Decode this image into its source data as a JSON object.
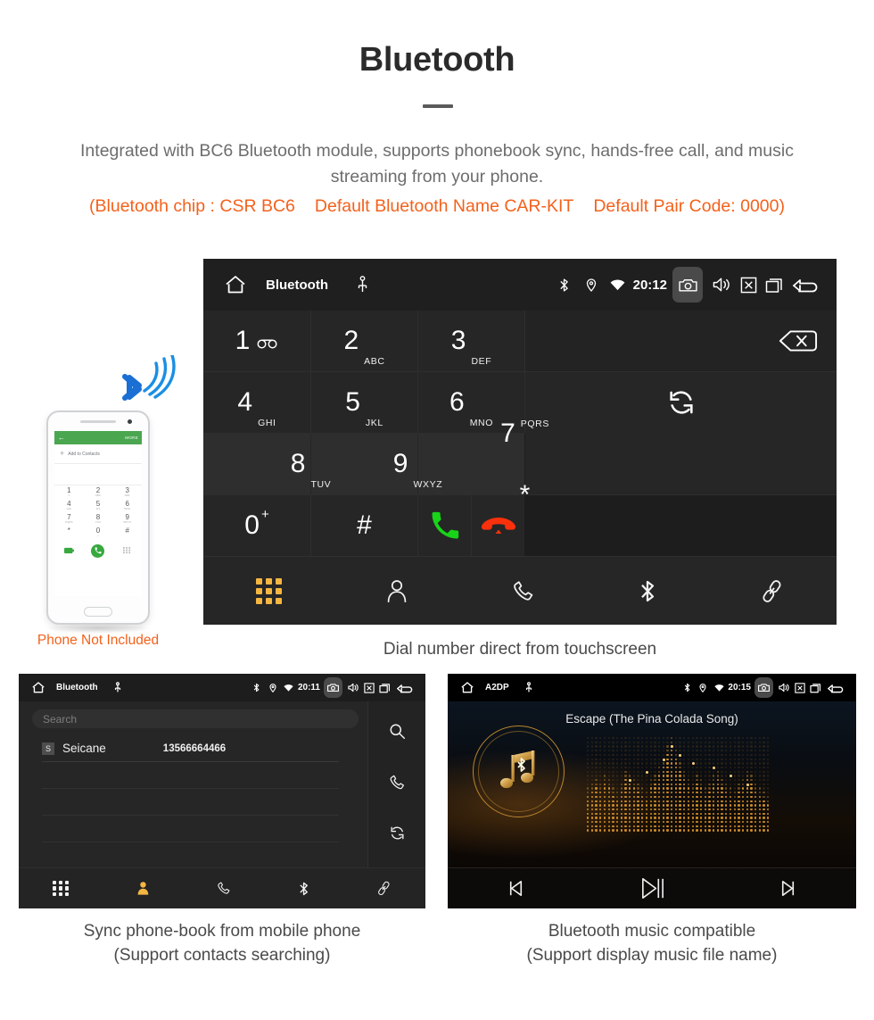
{
  "hero": {
    "title": "Bluetooth",
    "subtitle": "Integrated with BC6 Bluetooth module, supports phonebook sync, hands-free call, and music streaming from your phone.",
    "note_chip": "(Bluetooth chip : CSR BC6",
    "note_name": "Default Bluetooth Name CAR-KIT",
    "note_pair": "Default Pair Code: 0000)",
    "accent_color": "#f4611b",
    "text_color": "#6d6d6d"
  },
  "phone_illustration": {
    "caption": "Phone Not Included",
    "screen": {
      "back_glyph": "←",
      "more_label": "MORE",
      "add_plus": "+",
      "add_label": "Add to Contacts",
      "keys": [
        {
          "num": "1",
          "sub": "∞"
        },
        {
          "num": "2",
          "sub": "ABC"
        },
        {
          "num": "3",
          "sub": "DEF"
        },
        {
          "num": "4",
          "sub": "GHI"
        },
        {
          "num": "5",
          "sub": "JKL"
        },
        {
          "num": "6",
          "sub": "MNO"
        },
        {
          "num": "7",
          "sub": "PQRS"
        },
        {
          "num": "8",
          "sub": "TUV"
        },
        {
          "num": "9",
          "sub": "WXYZ"
        },
        {
          "num": "*",
          "sub": ""
        },
        {
          "num": "0",
          "sub": "+"
        },
        {
          "num": "#",
          "sub": ""
        }
      ]
    }
  },
  "dialer_unit": {
    "statusbar": {
      "home_icon": "home-icon",
      "title": "Bluetooth",
      "usb_icon": "usb-icon",
      "bluetooth_icon": "bluetooth-icon",
      "location_icon": "location-pin-icon",
      "wifi_icon": "wifi-icon",
      "clock": "20:12",
      "camera_icon": "camera-icon",
      "volume_icon": "speaker-icon",
      "close_icon": "close-box-icon",
      "recents_icon": "recents-icon",
      "back_icon": "back-arrow-icon"
    },
    "keys": [
      {
        "num": "1",
        "sub": "",
        "voicemail": true
      },
      {
        "num": "2",
        "sub": "ABC"
      },
      {
        "num": "3",
        "sub": "DEF"
      },
      {
        "num": "4",
        "sub": "GHI"
      },
      {
        "num": "5",
        "sub": "JKL"
      },
      {
        "num": "6",
        "sub": "MNO"
      },
      {
        "num": "7",
        "sub": "PQRS"
      },
      {
        "num": "8",
        "sub": "TUV"
      },
      {
        "num": "9",
        "sub": "WXYZ"
      },
      {
        "num": "*",
        "sub": ""
      },
      {
        "num": "0",
        "sub": "+"
      },
      {
        "num": "#",
        "sub": ""
      }
    ],
    "actions": {
      "backspace_icon": "backspace-icon",
      "sync_icon": "sync-icon",
      "call_icon": "call-icon",
      "hangup_icon": "hangup-icon",
      "call_color": "#18d318",
      "hangup_color": "#f8300c"
    },
    "navbar": [
      {
        "icon": "dialpad-icon",
        "active": true
      },
      {
        "icon": "contacts-icon",
        "active": false
      },
      {
        "icon": "call-log-icon",
        "active": false
      },
      {
        "icon": "bluetooth-icon",
        "active": false
      },
      {
        "icon": "link-icon",
        "active": false
      }
    ],
    "active_color": "#f5b642",
    "caption": "Dial number direct from touchscreen"
  },
  "phonebook_unit": {
    "statusbar": {
      "title": "Bluetooth",
      "clock": "20:11"
    },
    "search": {
      "placeholder": "Search",
      "value": ""
    },
    "contacts": [
      {
        "initial": "S",
        "name": "Seicane",
        "number": "13566664466"
      }
    ],
    "empty_rows": 3,
    "side_actions": [
      {
        "icon": "search-icon"
      },
      {
        "icon": "call-icon"
      },
      {
        "icon": "sync-icon"
      }
    ],
    "navbar": [
      {
        "icon": "dialpad-icon",
        "active": false
      },
      {
        "icon": "contacts-icon",
        "active": true
      },
      {
        "icon": "call-log-icon",
        "active": false
      },
      {
        "icon": "bluetooth-icon",
        "active": false
      },
      {
        "icon": "link-icon",
        "active": false
      }
    ],
    "caption_line1": "Sync phone-book from mobile phone",
    "caption_line2": "(Support contacts searching)"
  },
  "music_unit": {
    "statusbar": {
      "title": "A2DP",
      "clock": "20:15"
    },
    "track_title": "Escape (The Pina Colada Song)",
    "album_icon": "music-note-bluetooth-icon",
    "accent_color": "#c79038",
    "controls": [
      {
        "icon": "previous-track-icon"
      },
      {
        "icon": "play-pause-icon"
      },
      {
        "icon": "next-track-icon"
      }
    ],
    "caption_line1": "Bluetooth music compatible",
    "caption_line2": "(Support display music file name)"
  }
}
